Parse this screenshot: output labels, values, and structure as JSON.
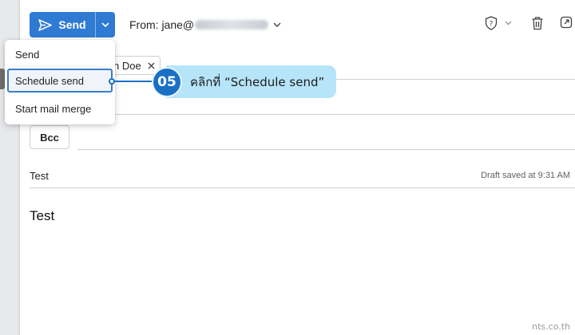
{
  "toolbar": {
    "send_label": "Send",
    "from_label": "From: jane@",
    "send_color": "#2f7ad3"
  },
  "recipients": {
    "chip_label": "n Doe",
    "bcc_label": "Bcc"
  },
  "message": {
    "subject": "Test",
    "draft_status": "Draft saved at 9:31 AM",
    "body": "Test"
  },
  "send_menu": {
    "items": [
      {
        "label": "Send"
      },
      {
        "label": "Schedule send"
      },
      {
        "label": "Start mail merge"
      }
    ]
  },
  "callout": {
    "step": "05",
    "text": "คลิกที่ “Schedule send”",
    "color": "#1a70c5"
  },
  "watermark": "nts.co.th",
  "icons": [
    "send-icon",
    "chevron-down-icon",
    "shield-question-icon",
    "trash-icon",
    "popout-icon",
    "close-icon"
  ]
}
